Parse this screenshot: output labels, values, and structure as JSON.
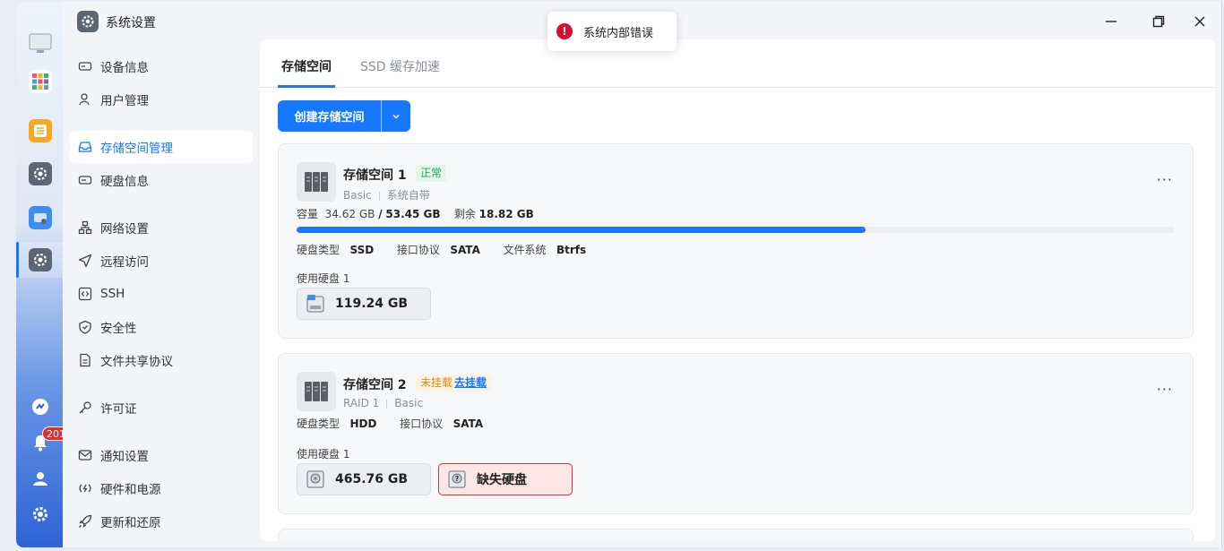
{
  "app": {
    "title": "系统设置",
    "icon": "gear-icon"
  },
  "toast": {
    "message": "系统内部错误",
    "icon": "error-icon"
  },
  "dock": {
    "notification_count": "201"
  },
  "sidebar": {
    "items": [
      {
        "label": "设备信息",
        "icon": "device-icon"
      },
      {
        "label": "用户管理",
        "icon": "user-icon"
      },
      {
        "label": "存储空间管理",
        "icon": "storage-icon",
        "active": true
      },
      {
        "label": "硬盘信息",
        "icon": "disk-icon"
      },
      {
        "label": "网络设置",
        "icon": "network-icon"
      },
      {
        "label": "远程访问",
        "icon": "send-icon"
      },
      {
        "label": "SSH",
        "icon": "ssh-icon"
      },
      {
        "label": "安全性",
        "icon": "shield-icon"
      },
      {
        "label": "文件共享协议",
        "icon": "file-icon"
      },
      {
        "label": "许可证",
        "icon": "key-icon"
      },
      {
        "label": "通知设置",
        "icon": "mail-icon"
      },
      {
        "label": "硬件和电源",
        "icon": "power-icon"
      },
      {
        "label": "更新和还原",
        "icon": "rocket-icon"
      }
    ]
  },
  "tabs": [
    {
      "label": "存储空间",
      "active": true
    },
    {
      "label": "SSD 缓存加速",
      "active": false
    }
  ],
  "create_button": {
    "label": "创建存储空间"
  },
  "pools": [
    {
      "name": "存储空间 1",
      "status": "正常",
      "type": "Basic",
      "filesystem_note": "系统自带",
      "capacity_label": "容量",
      "used": "34.62 GB",
      "separator": "/",
      "total": "53.45 GB",
      "remaining_label": "剩余",
      "remaining": "18.82 GB",
      "usage_fraction": 0.648,
      "disk_type_label": "硬盘类型",
      "disk_type": "SSD",
      "interface_label": "接口协议",
      "interface": "SATA",
      "fs_label": "文件系统",
      "fs": "Btrfs",
      "disks_label": "使用硬盘 1",
      "disks": [
        {
          "size": "119.24 GB"
        }
      ]
    },
    {
      "name": "存储空间 2",
      "status": "未挂载",
      "mount_link": "去挂载",
      "type": "RAID 1",
      "subtype": "Basic",
      "disk_type_label": "硬盘类型",
      "disk_type": "HDD",
      "interface_label": "接口协议",
      "interface": "SATA",
      "disks_label": "使用硬盘 1",
      "disks": [
        {
          "size": "465.76 GB"
        }
      ],
      "missing_disk_label": "缺失硬盘"
    }
  ],
  "more_icon": "···",
  "colors": {
    "accent": "#1677ff",
    "ok": "#2aa356",
    "warn": "#d98a12",
    "error": "#d8102c"
  }
}
